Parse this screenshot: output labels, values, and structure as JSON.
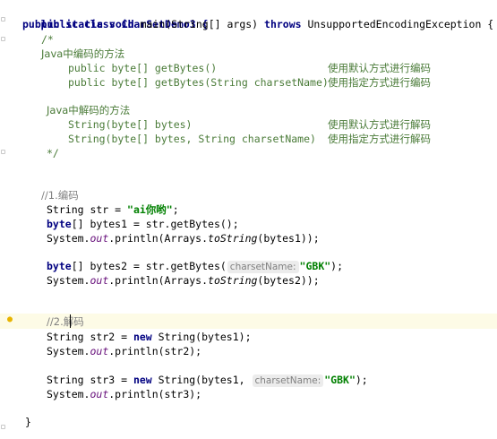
{
  "editor": {
    "lines": {
      "l1": "public class CharSetDemo3 {",
      "l2_kw": "public static void",
      "l2_main": " main(String[] args) ",
      "l2_throws": "throws",
      "l2_rest": " UnsupportedEncodingException {",
      "l3": "/*",
      "l4": "Java中编码的方法",
      "l5_code": "public byte[] getBytes()",
      "l5_desc": "使用默认方式进行编码",
      "l6_code": "public byte[] getBytes(String charsetName)",
      "l6_desc": "使用指定方式进行编码",
      "l7": "Java中解码的方法",
      "l8_code": "String(byte[] bytes)",
      "l8_desc": "使用默认方式进行解码",
      "l9_code": "String(byte[] bytes, String charsetName)",
      "l9_desc": "使用指定方式进行解码",
      "l10": "*/",
      "l11": "//1.编码",
      "l12_a": "String str = ",
      "l12_str": "\"ai你哟\"",
      "l12_b": ";",
      "l13_kw": "byte",
      "l13_rest": "[] bytes1 = str.getBytes();",
      "l14_a": "System.",
      "l14_out": "out",
      "l14_b": ".println(Arrays.",
      "l14_ts": "toString",
      "l14_c": "(bytes1));",
      "l15_kw": "byte",
      "l15_rest": "[] bytes2 = str.getBytes(",
      "l15_hint": "charsetName:",
      "l15_str": "\"GBK\"",
      "l15_end": ");",
      "l16_a": "System.",
      "l16_out": "out",
      "l16_b": ".println(Arrays.",
      "l16_ts": "toString",
      "l16_c": "(bytes2));",
      "l17": "//2.解码",
      "l18_a": "String str2 = ",
      "l18_new": "new",
      "l18_b": " String(bytes1);",
      "l19_a": "System.",
      "l19_out": "out",
      "l19_b": ".println(str2);",
      "l20_a": "String str3 = ",
      "l20_new": "new",
      "l20_b": " String(bytes1, ",
      "l20_hint": "charsetName:",
      "l20_str": "\"GBK\"",
      "l20_end": ");",
      "l21_a": "System.",
      "l21_out": "out",
      "l21_b": ".println(str3);",
      "l22": "}"
    },
    "icons": {
      "intention": "lightbulb-icon"
    }
  }
}
